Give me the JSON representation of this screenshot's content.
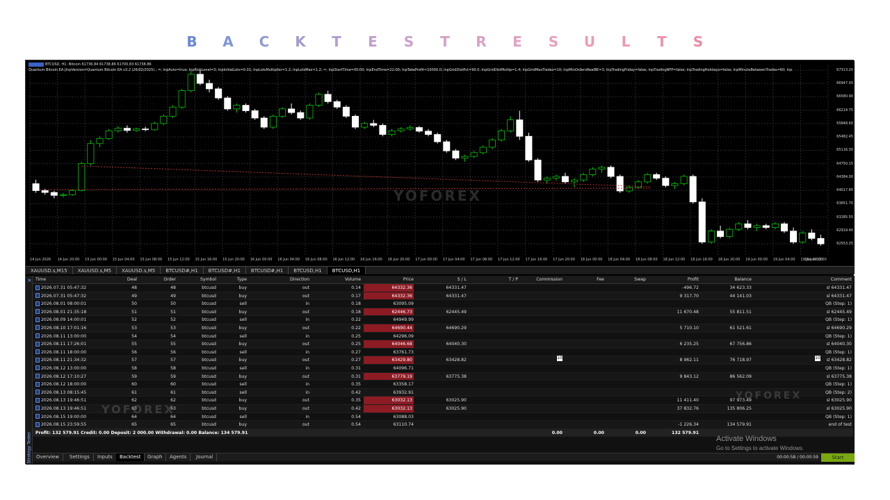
{
  "banner": {
    "letters": [
      "B",
      "A",
      "C",
      "K",
      "T",
      "E",
      "S",
      "T",
      "R",
      "E",
      "S",
      "U",
      "L",
      "T",
      "S"
    ],
    "colors": [
      "#6a87d6",
      "#7f94d8",
      "#9199d2",
      "#a39ccf",
      "#b29ecd",
      "#bfa0cc",
      "#c9a1ca",
      "#d3a2c8",
      "#dba2c5",
      "#e2a2c2",
      "#e89fbc",
      "#eb9bb6",
      "#ee97b0",
      "#ef92a9",
      "#ef8ca2"
    ]
  },
  "chart": {
    "header_line1": "BTCUSD, H1: Bitcoin 61736.84 61738.86 61700.83 61738.86",
    "header_line2": "Quantum Bitcoin EA [InpVersion=Quantum Bitcoin EA v3.2 (26/02/2025) ; =; InpAuto=true; InpRiskLevel=3; InpInitialLots=0.01; InpLotsMultiplier=1.2; InpLotsMax=1.2; =; InpStartTime=00:00; InpEndTime=22:00; InpTakeProfit=10000.0; InpGridDistPct=90.0; InpGridDistMultip=1.4; InpGridMaxTrades=10; InpMinOrdersRealBE=3; InpTradingFriday=false; InpTradingNFP=false; InpTradingHolidays=false; InpMinuteBetweenTrades=60; Inp",
    "price_labels": [
      "67313.20",
      "66947.05",
      "66580.90",
      "66214.75",
      "65848.60",
      "65482.45",
      "65116.30",
      "64750.15",
      "64384.00",
      "64017.85",
      "63651.70",
      "63285.55",
      "62919.40",
      "62553.25"
    ],
    "time_labels": [
      "14 Jun 2026",
      "14 Jun 20:00",
      "15 Jun 00:00",
      "15 Jun 04:00",
      "15 Jun 08:00",
      "15 Jun 12:00",
      "15 Jun 16:00",
      "15 Jun 20:00",
      "16 Jun 00:00",
      "16 Jun 04:00",
      "16 Jun 08:00",
      "16 Jun 12:00",
      "16 Jun 16:00",
      "16 Jun 20:00",
      "17 Jun 00:00",
      "17 Jun 04:00",
      "17 Jun 08:00",
      "17 Jun 12:00",
      "17 Jun 16:00",
      "17 Jun 20:00",
      "18 Jun 00:00",
      "18 Jun 04:00",
      "18 Jun 08:00",
      "18 Jun 12:00",
      "18 Jun 16:00",
      "18 Jun 20:00",
      "19 Jun 00:00",
      "19 Jun 04:00",
      "19 Jun 08:00",
      "19 Jun 12:00"
    ],
    "candles": [
      [
        64200,
        64310,
        63950,
        64010
      ],
      [
        64010,
        64060,
        63900,
        63960
      ],
      [
        63960,
        64000,
        63800,
        63880
      ],
      [
        63880,
        63950,
        63820,
        63900
      ],
      [
        63900,
        64050,
        63870,
        64010
      ],
      [
        64010,
        64800,
        63990,
        64750
      ],
      [
        64750,
        65400,
        64700,
        65300
      ],
      [
        65300,
        65500,
        65200,
        65440
      ],
      [
        65440,
        65700,
        65400,
        65650
      ],
      [
        65650,
        65780,
        65600,
        65720
      ],
      [
        65720,
        65800,
        65600,
        65660
      ],
      [
        65660,
        65740,
        65620,
        65700
      ],
      [
        65700,
        65760,
        65640,
        65680
      ],
      [
        65680,
        65900,
        65650,
        65850
      ],
      [
        65850,
        66100,
        65800,
        66050
      ],
      [
        66050,
        66350,
        66000,
        66300
      ],
      [
        66300,
        66800,
        66250,
        66750
      ],
      [
        66750,
        67300,
        66700,
        67200
      ],
      [
        67200,
        67310,
        66900,
        66950
      ],
      [
        66950,
        67050,
        66700,
        66800
      ],
      [
        66800,
        66850,
        66500,
        66550
      ],
      [
        66550,
        66600,
        66200,
        66250
      ],
      [
        66250,
        66400,
        66150,
        66350
      ],
      [
        66350,
        66400,
        66150,
        66200
      ],
      [
        66200,
        66250,
        65950,
        66000
      ],
      [
        66000,
        66050,
        65700,
        65750
      ],
      [
        65750,
        66100,
        65700,
        66050
      ],
      [
        66050,
        66300,
        66000,
        66250
      ],
      [
        66250,
        66400,
        66100,
        66150
      ],
      [
        66150,
        66200,
        65950,
        66000
      ],
      [
        66000,
        66400,
        65950,
        66350
      ],
      [
        66350,
        66700,
        66300,
        66650
      ],
      [
        66650,
        66750,
        66400,
        66450
      ],
      [
        66450,
        66500,
        66250,
        66300
      ],
      [
        66300,
        66350,
        66000,
        66050
      ],
      [
        66050,
        66100,
        65700,
        65750
      ],
      [
        65750,
        65900,
        65700,
        65850
      ],
      [
        65850,
        65950,
        65750,
        65800
      ],
      [
        65800,
        65850,
        65500,
        65550
      ],
      [
        65550,
        65700,
        65500,
        65650
      ],
      [
        65650,
        65750,
        65600,
        65700
      ],
      [
        65700,
        65800,
        65650,
        65740
      ],
      [
        65740,
        65780,
        65600,
        65640
      ],
      [
        65640,
        65700,
        65500,
        65550
      ],
      [
        65550,
        65600,
        65300,
        65350
      ],
      [
        65350,
        65400,
        65050,
        65100
      ],
      [
        65100,
        65150,
        64850,
        64900
      ],
      [
        64900,
        65000,
        64800,
        64950
      ],
      [
        64950,
        65100,
        64900,
        65050
      ],
      [
        65050,
        65250,
        65000,
        65200
      ],
      [
        65200,
        65450,
        65150,
        65400
      ],
      [
        65400,
        65700,
        65350,
        65650
      ],
      [
        65650,
        66050,
        65600,
        65950
      ],
      [
        65950,
        66200,
        65400,
        65500
      ],
      [
        65500,
        65600,
        64800,
        64850
      ],
      [
        64850,
        64900,
        64250,
        64300
      ],
      [
        64300,
        64400,
        64200,
        64350
      ],
      [
        64350,
        64450,
        64280,
        64400
      ],
      [
        64400,
        64500,
        64200,
        64250
      ],
      [
        64250,
        64350,
        64100,
        64300
      ],
      [
        64300,
        64500,
        64250,
        64450
      ],
      [
        64450,
        64650,
        64400,
        64600
      ],
      [
        64600,
        64700,
        64500,
        64650
      ],
      [
        64650,
        64700,
        64350,
        64400
      ],
      [
        64400,
        64450,
        63950,
        64000
      ],
      [
        64000,
        64150,
        63950,
        64100
      ],
      [
        64100,
        64300,
        64050,
        64250
      ],
      [
        64250,
        64500,
        64200,
        64450
      ],
      [
        64450,
        64500,
        64300,
        64350
      ],
      [
        64350,
        64400,
        64100,
        64150
      ],
      [
        64150,
        64250,
        64050,
        64200
      ],
      [
        64200,
        64450,
        64150,
        64400
      ],
      [
        64400,
        64450,
        63650,
        63700
      ],
      [
        63700,
        63800,
        62550,
        62600
      ],
      [
        62600,
        62950,
        62550,
        62900
      ],
      [
        62900,
        63050,
        62700,
        62750
      ],
      [
        62750,
        63000,
        62700,
        62950
      ],
      [
        62950,
        63150,
        62900,
        63100
      ],
      [
        63100,
        63200,
        62950,
        63000
      ],
      [
        63000,
        63100,
        62900,
        63050
      ],
      [
        63050,
        63100,
        62950,
        63000
      ],
      [
        63000,
        63150,
        62950,
        63100
      ],
      [
        63100,
        63150,
        62850,
        62900
      ],
      [
        62900,
        63000,
        62550,
        62600
      ],
      [
        62600,
        62900,
        62550,
        62850
      ],
      [
        62850,
        62950,
        62650,
        62700
      ],
      [
        62700,
        62800,
        62500,
        62550
      ]
    ],
    "tabs": [
      "XAUUSD.s,M15",
      "XAUUSD.s,M5",
      "XAUUSD.s,M5",
      "BTCUSD#,H1",
      "BTCUSD#,H1",
      "BTCUSD#,H1",
      "BTCUSD,H1",
      "BTCUSD,H1"
    ],
    "active_tab": 7,
    "watermark": "YOFOREX"
  },
  "table": {
    "headers": [
      "Time",
      "Deal",
      "Order",
      "Symbol",
      "Type",
      "Direction",
      "Volume",
      "Price",
      "S / L",
      "T / P",
      "Commission",
      "Fee",
      "Swap",
      "Profit",
      "Balance",
      "Comment"
    ],
    "rows": [
      [
        "2026.07.31 05:47:32",
        "48",
        "48",
        "btcusd",
        "buy",
        "out",
        "0.14",
        "64332.36",
        "64331.47",
        "",
        "",
        "",
        "",
        "-496.72",
        "34 623.33",
        "sl 64331.47"
      ],
      [
        "2026.07.31 05:47:32",
        "49",
        "49",
        "btcusd",
        "buy",
        "out",
        "0.17",
        "64332.36",
        "64331.47",
        "",
        "",
        "",
        "",
        "9 317.70",
        "44 141.03",
        "sl 64331.47"
      ],
      [
        "2026.08.01 08:00:01",
        "50",
        "50",
        "btcusd",
        "sell",
        "in",
        "0.18",
        "63095.09",
        "",
        "",
        "",
        "",
        "",
        "",
        "",
        "QB (Step: 1)"
      ],
      [
        "2026.08.01 21:35:18",
        "51",
        "51",
        "btcusd",
        "buy",
        "out",
        "0.18",
        "62446.73",
        "62445.49",
        "",
        "",
        "",
        "",
        "11 670.48",
        "55 811.51",
        "sl 62445.49"
      ],
      [
        "2026.08.09 14:00:01",
        "52",
        "52",
        "btcusd",
        "sell",
        "in",
        "0.22",
        "64949.99",
        "",
        "",
        "",
        "",
        "",
        "",
        "",
        "QB (Step: 1)"
      ],
      [
        "2026.08.10 17:01:16",
        "53",
        "53",
        "btcusd",
        "buy",
        "out",
        "0.22",
        "64690.44",
        "64690.29",
        "",
        "",
        "",
        "",
        "5 710.10",
        "61 521.61",
        "sl 64690.29"
      ],
      [
        "2026.08.11 13:00:00",
        "54",
        "54",
        "btcusd",
        "sell",
        "in",
        "0.25",
        "64296.09",
        "",
        "",
        "",
        "",
        "",
        "",
        "",
        "QB (Step: 1)"
      ],
      [
        "2026.08.11 17:26:01",
        "55",
        "55",
        "btcusd",
        "buy",
        "out",
        "0.25",
        "64046.68",
        "64040.30",
        "",
        "",
        "",
        "",
        "6 235.25",
        "67 756.86",
        "sl 64040.30"
      ],
      [
        "2026.08.11 18:00:00",
        "56",
        "56",
        "btcusd",
        "sell",
        "in",
        "0.27",
        "63761.73",
        "",
        "",
        "",
        "",
        "",
        "",
        "",
        "QB (Step: 1)"
      ],
      [
        "2026.08.11 21:34:32",
        "57",
        "57",
        "btcusd",
        "buy",
        "out",
        "0.27",
        "63429.80",
        "63428.82",
        "",
        "",
        "",
        "",
        "8 962.11",
        "76 718.97",
        "sl 63428.82"
      ],
      [
        "2026.08.12 13:00:00",
        "58",
        "58",
        "btcusd",
        "sell",
        "in",
        "0.31",
        "64096.71",
        "",
        "",
        "",
        "",
        "",
        "",
        "",
        "QB (Step: 1)"
      ],
      [
        "2026.08.12 17:10:27",
        "59",
        "59",
        "btcusd",
        "buy",
        "out",
        "0.31",
        "63779.19",
        "63775.38",
        "",
        "",
        "",
        "",
        "9 843.12",
        "86 562.09",
        "sl 63775.38"
      ],
      [
        "2026.08.12 18:00:00",
        "60",
        "60",
        "btcusd",
        "sell",
        "in",
        "0.35",
        "63358.17",
        "",
        "",
        "",
        "",
        "",
        "",
        "",
        "QB (Step: 1)"
      ],
      [
        "2026.08.13 08:15:45",
        "61",
        "61",
        "btcusd",
        "sell",
        "in",
        "0.42",
        "63932.91",
        "",
        "",
        "",
        "",
        "",
        "",
        "",
        "QB (Step: 2)"
      ],
      [
        "2026.08.13 19:46:51",
        "62",
        "62",
        "btcusd",
        "buy",
        "out",
        "0.35",
        "63032.13",
        "63025.90",
        "",
        "",
        "",
        "",
        "11 411.40",
        "97 973.49",
        "sl 63025.90"
      ],
      [
        "2026.08.13 19:46:51",
        "63",
        "63",
        "btcusd",
        "buy",
        "out",
        "0.42",
        "63032.13",
        "63025.90",
        "",
        "",
        "",
        "",
        "37 832.76",
        "135 806.25",
        "sl 63025.90"
      ],
      [
        "2026.08.15 19:00:00",
        "64",
        "64",
        "btcusd",
        "sell",
        "in",
        "0.54",
        "63088.03",
        "",
        "",
        "",
        "",
        "",
        "",
        "",
        "QB (Step: 1)"
      ],
      [
        "2026.08.15 23:59:55",
        "65",
        "65",
        "btcusd",
        "buy",
        "out",
        "0.54",
        "63110.74",
        "",
        "",
        "",
        "",
        "",
        "-1 226.34",
        "134 579.91",
        "end of test"
      ]
    ],
    "highlighted_rows": [
      0,
      1,
      3,
      5,
      7,
      9,
      11,
      14,
      15
    ],
    "totals": {
      "summary": "Profit: 132 579.91  Credit: 0.00  Deposit: 2 000.00  Withdrawal: 0.00  Balance: 134 579.91",
      "commission": "0.00",
      "fee": "0.00",
      "swap": "0.00",
      "profit": "132 579.91"
    },
    "badge1": "10",
    "badge2": "10"
  },
  "tester": {
    "side_label": "Strategy Tester",
    "close_glyph": "×",
    "tabs": [
      "Overview",
      "Settings",
      "Inputs",
      "Backtest",
      "Graph",
      "Agents",
      "Journal"
    ],
    "active_tab": 3,
    "timer": "00:00:58 / 00:00:59",
    "start": "Start"
  },
  "overlay": {
    "activate_title": "Activate Windows",
    "activate_sub": "Go to Settings to activate Windows.",
    "watermark": "YOFOREX"
  },
  "colors": {
    "bull": "#00c800",
    "bear": "#ffffff",
    "grid": "#2a2a2a",
    "highlight": "#8c1b24",
    "start_button": "#79a80f"
  }
}
